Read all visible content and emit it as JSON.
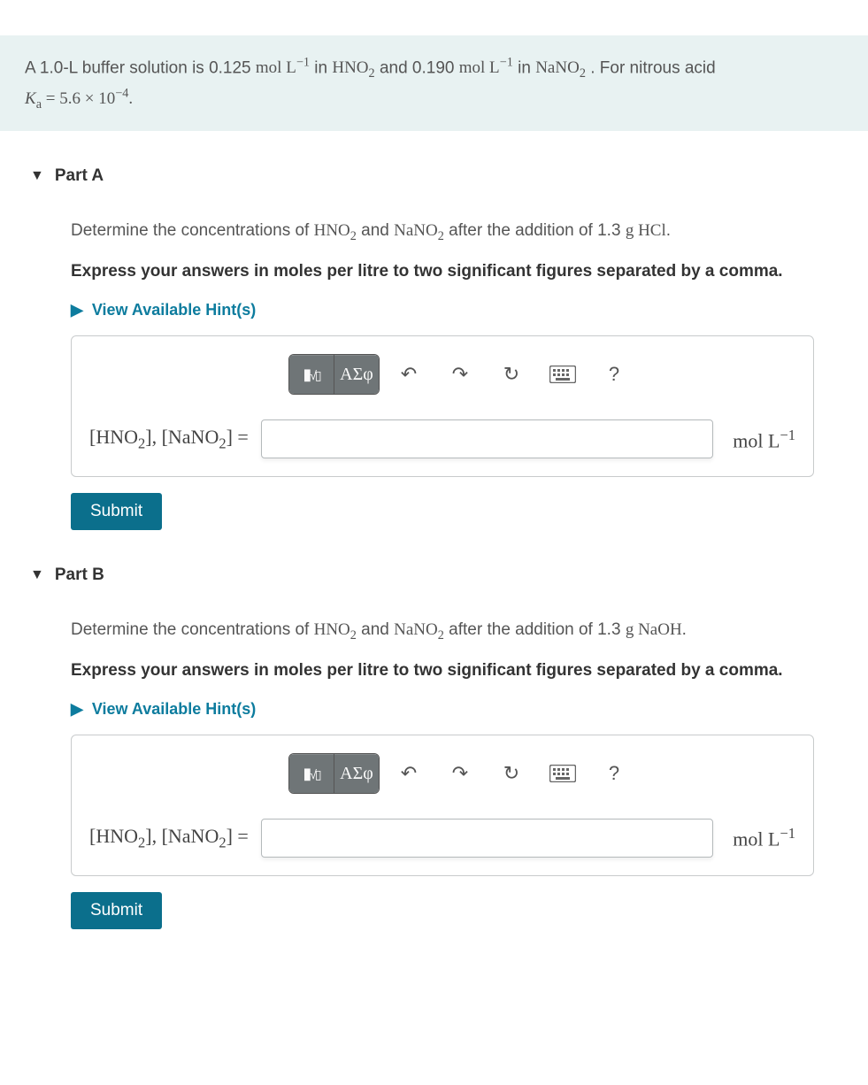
{
  "intro": {
    "pre": "A 1.0-L buffer solution is 0.125 ",
    "unit1": "mol L",
    "mid1": " in ",
    "hno2": "HNO",
    "mid2": " and 0.190 ",
    "mid3": " in ",
    "nano2": "NaNO",
    "mid4": ". For nitrous acid",
    "ka_lhs": "K",
    "ka_sub": "a",
    "ka_eq": " = 5.6 × 10",
    "ka_exp": "−4",
    "period": "."
  },
  "hints_text": "View Available Hint(s)",
  "toolbar": {
    "greek": "ΑΣφ",
    "help": "?"
  },
  "answer": {
    "label_open": "[HNO",
    "label_mid": "], [NaNO",
    "label_close": "] =",
    "unit_base": "mol L",
    "unit_exp": "−1"
  },
  "submit_label": "Submit",
  "partA": {
    "title": "Part A",
    "q_pre": "Determine the concentrations of ",
    "q_mid": " and ",
    "q_mid2": " after the addition of 1.3 ",
    "q_g": "g",
    "q_reagent": " HCl",
    "q_end": ".",
    "instruction": "Express your answers in moles per litre to two significant figures separated by a comma."
  },
  "partB": {
    "title": "Part B",
    "q_pre": "Determine the concentrations of ",
    "q_mid": " and ",
    "q_mid2": " after the addition of 1.3 ",
    "q_g": "g",
    "q_reagent": " NaOH",
    "q_end": ".",
    "instruction": "Express your answers in moles per litre to two significant figures separated by a comma."
  }
}
